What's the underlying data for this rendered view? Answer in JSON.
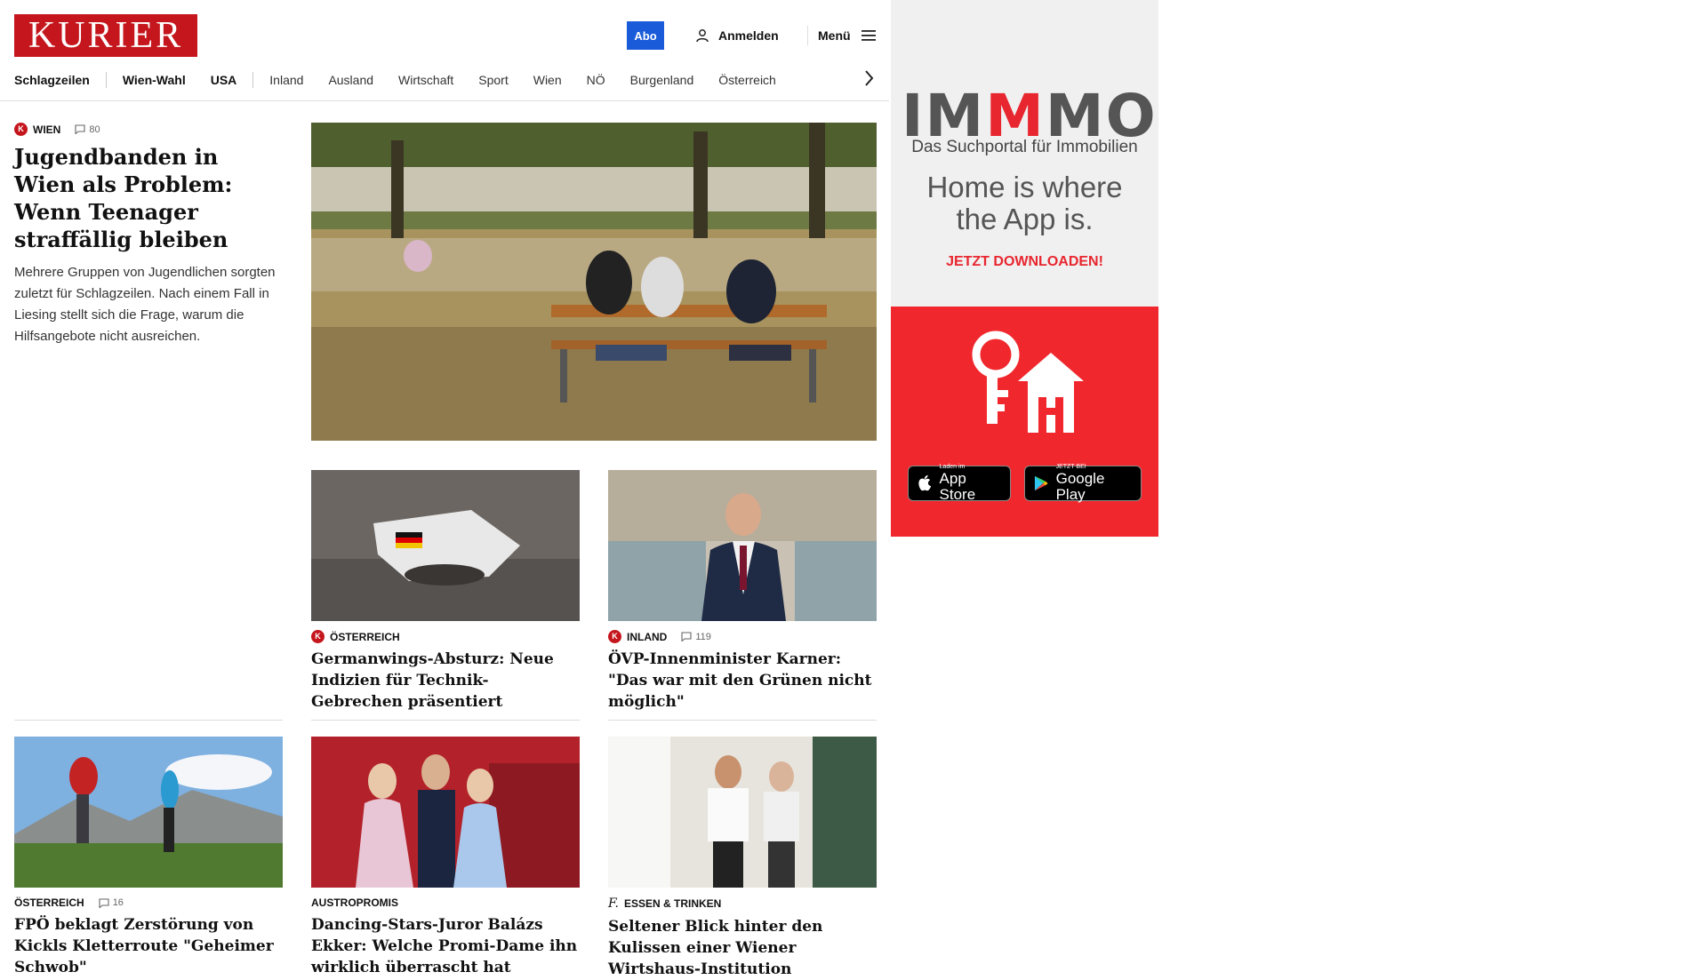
{
  "header": {
    "logo": "KURIER",
    "abo_label": "Abo",
    "login_label": "Anmelden",
    "menu_label": "Menü"
  },
  "nav": {
    "items": [
      "Schlagzeilen",
      "Wien-Wahl",
      "USA",
      "Inland",
      "Ausland",
      "Wirtschaft",
      "Sport",
      "Wien",
      "NÖ",
      "Burgenland",
      "Österreich"
    ]
  },
  "lead": {
    "category": "WIEN",
    "comments": "80",
    "title": "Jugendbanden in Wien als Problem: Wenn Teenager straffällig bleiben",
    "teaser": "Mehrere Gruppen von Jugendlichen sorgten zuletzt für Schlagzeilen. Nach einem Fall in Liesing stellt sich die Frage, warum die Hilfsangebote nicht ausreichen."
  },
  "cards": [
    {
      "category": "ÖSTERREICH",
      "comments": "",
      "title": "Germanwings-Absturz: Neue Indizien für Technik-Gebrechen präsentiert"
    },
    {
      "category": "INLAND",
      "comments": "119",
      "title": "ÖVP-Innenminister Karner: \"Das war mit den Grünen nicht möglich\""
    },
    {
      "category": "ÖSTERREICH",
      "comments": "16",
      "title": "FPÖ beklagt Zerstörung von Kickls Kletterroute \"Geheimer Schwob\""
    },
    {
      "category": "AUSTROPROMIS",
      "comments": "",
      "title": "Dancing-Stars-Juror Balázs Ekker: Welche Promi-Dame ihn wirklich überrascht hat"
    },
    {
      "category": "ESSEN & TRINKEN",
      "comments": "",
      "title": "Seltener Blick hinter den Kulissen einer Wiener Wirtshaus-Institution"
    }
  ],
  "ad": {
    "brand_part1": "IM",
    "brand_part2": "M",
    "brand_part3": "MO",
    "subtitle": "Das Suchportal für Immobilien",
    "headline": "Home is where the App is.",
    "cta": "JETZT DOWNLOADEN!",
    "appstore_small": "Laden im",
    "appstore_big": "App Store",
    "googleplay_small": "JETZT BEI",
    "googleplay_big": "Google Play"
  },
  "colors": {
    "brand_red": "#c4161c",
    "abo_blue": "#1a5bd9",
    "ad_red": "#f0272d"
  }
}
